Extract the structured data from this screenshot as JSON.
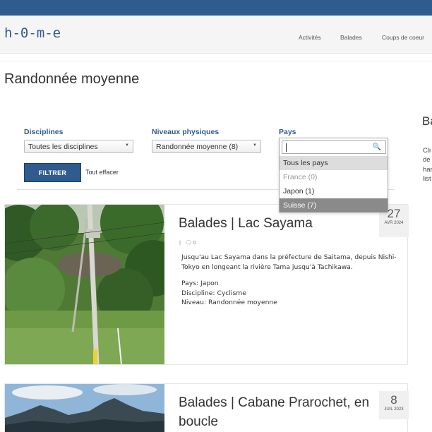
{
  "site": {
    "logo": "h-0-m-e",
    "nav": [
      "Activités",
      "Balades",
      "Coups de coeur"
    ]
  },
  "page": {
    "title": "Randonnée moyenne"
  },
  "filters": {
    "disciplines": {
      "label": "Disciplines",
      "value": "Toutes les disciplines"
    },
    "niveaux": {
      "label": "Niveaux physiques",
      "value": "Randonnée moyenne (8)"
    },
    "pays": {
      "label": "Pays",
      "search_value": "",
      "options": [
        {
          "label": "Tous les pays",
          "state": "selected"
        },
        {
          "label": "France (0)",
          "state": "disabled"
        },
        {
          "label": "Japon (1)",
          "state": "normal"
        },
        {
          "label": "Suisse (7)",
          "state": "highlighted"
        }
      ]
    },
    "submit_label": "FILTRER",
    "clear_label": "Tout effacer"
  },
  "sidebar": {
    "title": "Ba",
    "lines": [
      "Cli",
      "de",
      "har",
      "list"
    ]
  },
  "posts": [
    {
      "title": "Balades | Lac Sayama",
      "date_day": "27",
      "date_month": "AVR 2024",
      "comments": "0",
      "excerpt": "Jusqu'au Lac Sayama dans la préfecture de Saitama, depuis Nishi-Tokyo en longeant la rivière Tama jusqu'à Tachikawa.",
      "pays": "Pays: Japon",
      "discipline": "Discipline: Cyclisme",
      "niveau": "Niveau: Randonnée moyenne"
    },
    {
      "title_line1": "Balades | Cabane Prarochet, en",
      "title_line2": "boucle",
      "date_day": "8",
      "date_month": "JUIL 2023"
    }
  ],
  "colors": {
    "brand": "#2f5b8e",
    "highlight": "#8a8a8a",
    "selected": "#dddddd"
  }
}
